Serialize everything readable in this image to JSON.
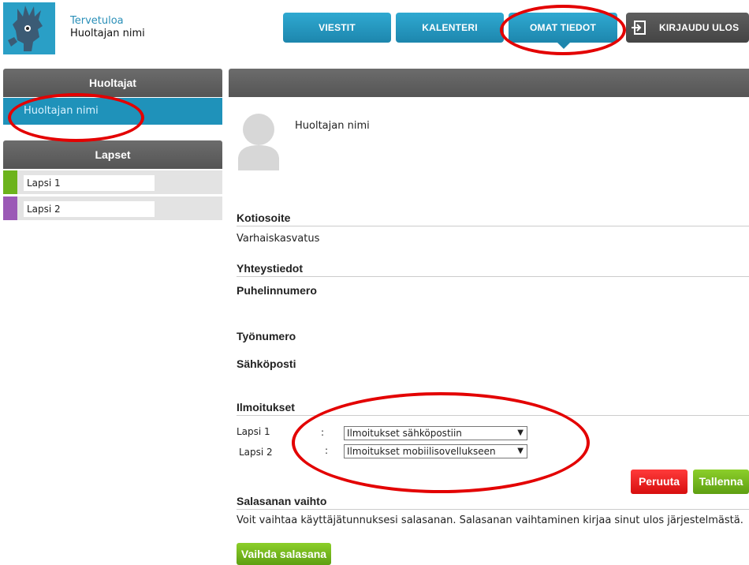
{
  "header": {
    "welcome": "Tervetuloa",
    "user_name": "Huoltajan nimi",
    "nav": {
      "messages": "VIESTIT",
      "calendar": "KALENTERI",
      "own_info": "OMAT TIEDOT",
      "logout": "KIRJAUDU ULOS"
    }
  },
  "sidebar": {
    "guardians_title": "Huoltajat",
    "guardian_name": "Huoltajan nimi",
    "children_title": "Lapset",
    "children": [
      {
        "name": "Lapsi 1",
        "color": "#6cb31c"
      },
      {
        "name": "Lapsi 2",
        "color": "#9b59b6"
      }
    ]
  },
  "main": {
    "profile_name": "Huoltajan nimi",
    "home_address_title": "Kotiosoite",
    "home_address_value": "Varhaiskasvatus",
    "contact_title": "Yhteystiedot",
    "phone_label": "Puhelinnumero",
    "work_phone_label": "Työnumero",
    "email_label": "Sähköposti",
    "notifications_title": "Ilmoitukset",
    "notifications": [
      {
        "child": "Lapsi 1",
        "colon": ":",
        "selected": "Ilmoitukset sähköpostiin"
      },
      {
        "child": "Lapsi 2",
        "colon": ":",
        "selected": "Ilmoitukset mobiilisovellukseen"
      }
    ],
    "cancel_label": "Peruuta",
    "save_label": "Tallenna",
    "password_title": "Salasanan vaihto",
    "password_text": "Voit vaihtaa käyttäjätunnuksesi salasanan. Salasanan vaihtaminen kirjaa sinut ulos järjestelmästä.",
    "change_password_label": "Vaihda salasana"
  },
  "colors": {
    "accent": "#1f92ba",
    "annotation": "#e30000"
  }
}
